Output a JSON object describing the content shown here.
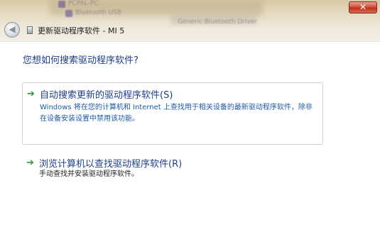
{
  "window": {
    "close_label": "✕",
    "background_text": [
      "PCPAL-PC",
      "Bluetooth USB",
      "Generic Bluetooth Driver"
    ]
  },
  "nav": {
    "back_icon": "back-arrow-icon",
    "title": "更新驱动程序软件 - MI 5"
  },
  "main": {
    "question": "您想如何搜索驱动程序软件?",
    "options": [
      {
        "icon": "green-arrow-icon",
        "title": "自动搜索更新的驱动程序软件(S)",
        "description": "Windows 将在您的计算机和 Internet 上查找用于相关设备的最新驱动程序软件，除非在设备安装设置中禁用该功能。"
      },
      {
        "icon": "green-arrow-icon",
        "title": "浏览计算机以查找驱动程序软件(R)",
        "description": "手动查找并安装驱动程序软件。"
      }
    ]
  },
  "colors": {
    "heading": "#1f3d8a",
    "link_blue": "#1e3f8f",
    "arrow_green": "#2f9a3a",
    "close_red": "#c0301c"
  }
}
